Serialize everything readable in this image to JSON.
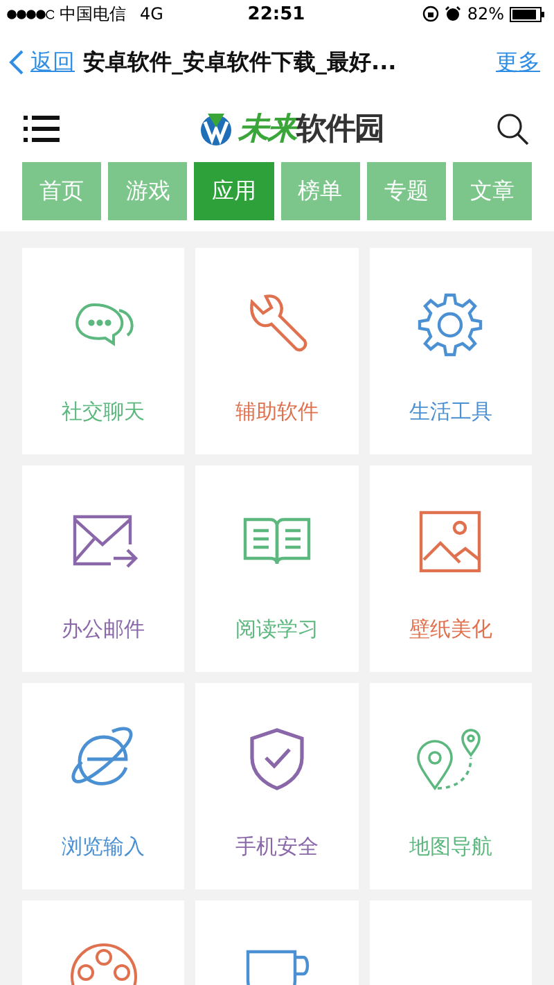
{
  "status_bar": {
    "carrier": "中国电信",
    "network": "4G",
    "time": "22:51",
    "battery": "82%"
  },
  "nav_bar": {
    "back": "返回",
    "title": "安卓软件_安卓软件下载_最好...",
    "more": "更多"
  },
  "logo": {
    "accent": "未来",
    "rest": "软件园"
  },
  "tabs": [
    {
      "label": "首页",
      "selected": false
    },
    {
      "label": "游戏",
      "selected": false
    },
    {
      "label": "应用",
      "selected": true
    },
    {
      "label": "榜单",
      "selected": false
    },
    {
      "label": "专题",
      "selected": false
    },
    {
      "label": "文章",
      "selected": false
    }
  ],
  "categories": [
    {
      "kind": "chat",
      "label": "社交聊天",
      "color": "#5cb87e"
    },
    {
      "kind": "wrench",
      "label": "辅助软件",
      "color": "#e0714f"
    },
    {
      "kind": "gear",
      "label": "生活工具",
      "color": "#4a90d2"
    },
    {
      "kind": "mail",
      "label": "办公邮件",
      "color": "#8a67a8"
    },
    {
      "kind": "book",
      "label": "阅读学习",
      "color": "#5cb87e"
    },
    {
      "kind": "image",
      "label": "壁纸美化",
      "color": "#e0714f"
    },
    {
      "kind": "globe",
      "label": "浏览输入",
      "color": "#4a90d2"
    },
    {
      "kind": "shield",
      "label": "手机安全",
      "color": "#8a67a8"
    },
    {
      "kind": "pin",
      "label": "地图导航",
      "color": "#5cb87e"
    },
    {
      "kind": "film",
      "color": "#e0714f"
    },
    {
      "kind": "cup",
      "color": "#4a90d2"
    }
  ]
}
